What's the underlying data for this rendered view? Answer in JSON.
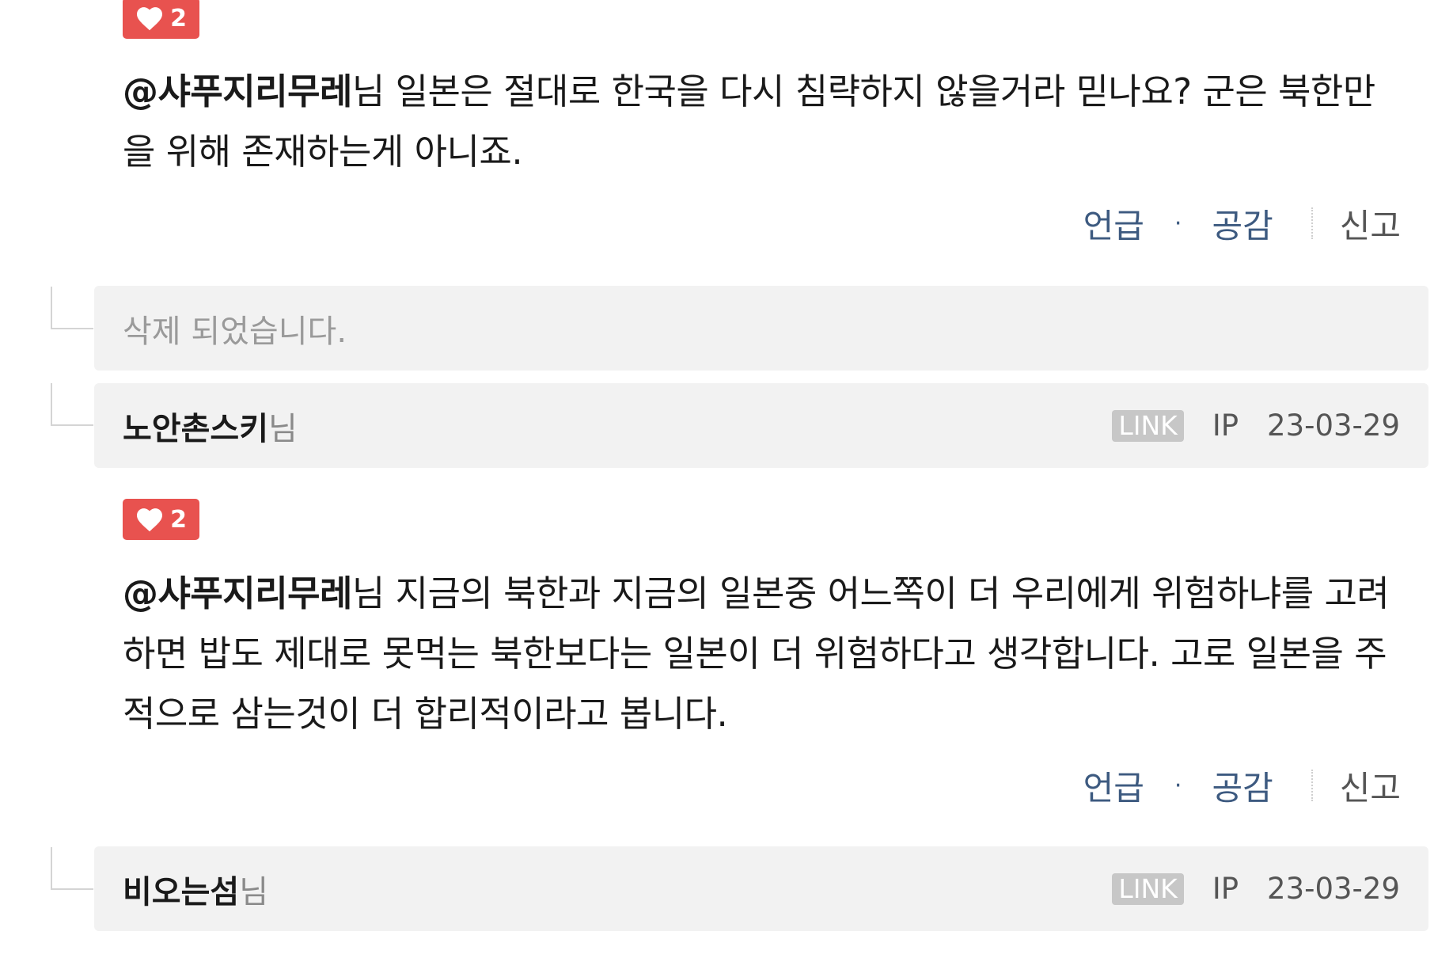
{
  "comments": [
    {
      "likes": "2",
      "mention": "@샤푸지리무레",
      "body": "님 일본은 절대로 한국을 다시 침략하지 않을거라 믿나요? 군은 북한만을 위해 존재하는게 아니죠.",
      "actions": {
        "mention": "언급",
        "dot": "·",
        "like": "공감",
        "report": "신고"
      }
    },
    {
      "likes": "2",
      "mention": "@샤푸지리무레",
      "body": "님 지금의 북한과 지금의 일본중 어느쪽이 더 우리에게 위험하냐를 고려하면 밥도 제대로 못먹는 북한보다는 일본이 더 위험하다고 생각합니다. 고로 일본을 주적으로 삼는것이 더 합리적이라고 봅니다.",
      "actions": {
        "mention": "언급",
        "dot": "·",
        "like": "공감",
        "report": "신고"
      }
    }
  ],
  "deleted_reply": {
    "text": "삭제 되었습니다."
  },
  "replies": [
    {
      "author": "노안촌스키",
      "suffix": "님",
      "link": "LINK",
      "ip": "IP",
      "date": "23-03-29"
    },
    {
      "author": "비오는섬",
      "suffix": "님",
      "link": "LINK",
      "ip": "IP",
      "date": "23-03-29"
    }
  ],
  "icons": {
    "like": "heart-icon"
  },
  "colors": {
    "like_badge": "#e8524f",
    "action_link": "#3d5a80",
    "row_bg": "#f2f2f2"
  }
}
